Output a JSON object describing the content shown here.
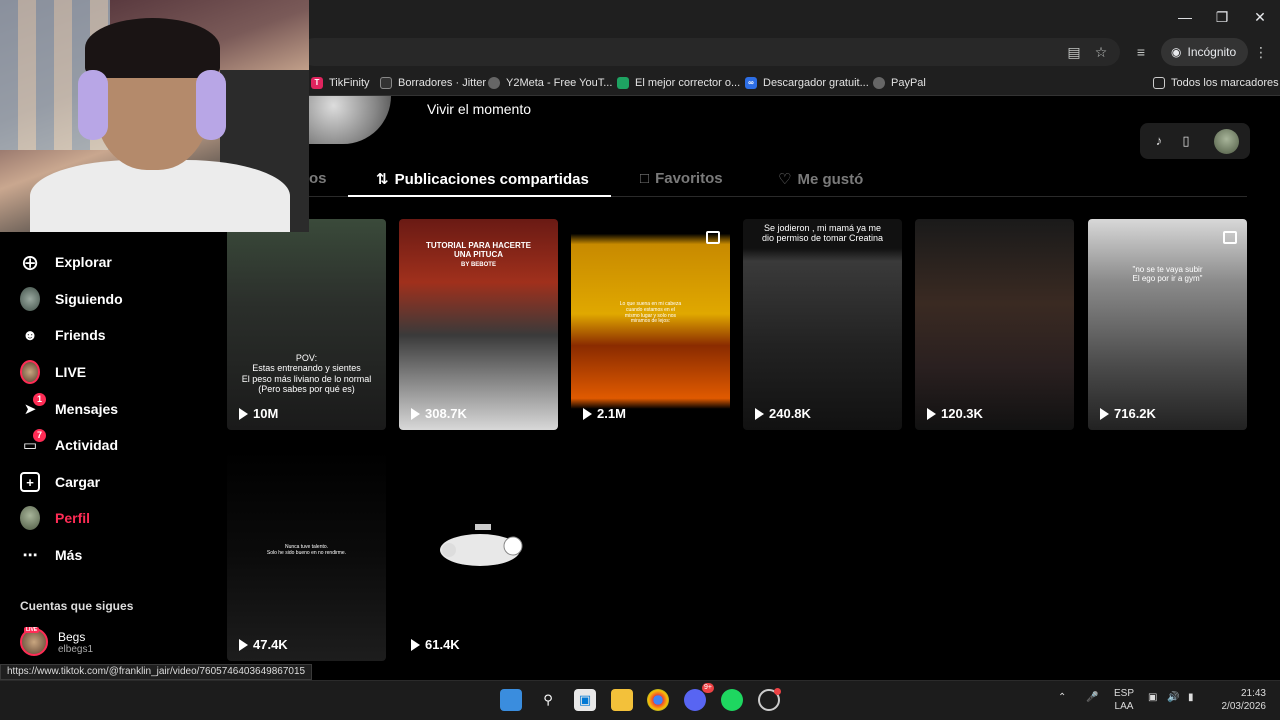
{
  "browser": {
    "incognito_label": "Incógnito",
    "bookmarks": [
      {
        "label": "TikFinity",
        "color": "#e0245e"
      },
      {
        "label": "Borradores · Jitter",
        "color": "#444444"
      },
      {
        "label": "Y2Meta - Free YouT...",
        "color": "#555555"
      },
      {
        "label": "El mejor corrector o...",
        "color": "#1ea362"
      },
      {
        "label": "Descargador gratuit...",
        "color": "#2d6ee5"
      },
      {
        "label": "PayPal",
        "color": "#555555"
      }
    ],
    "all_bookmarks_label": "Todos los marcadores"
  },
  "profile": {
    "bio": "Vivir el momento"
  },
  "tabs": {
    "partial": "os",
    "shared": "Publicaciones compartidas",
    "favorites": "Favoritos",
    "liked": "Me gustó"
  },
  "sidebar": {
    "items": [
      {
        "label": "Explorar",
        "icon": "compass-icon"
      },
      {
        "label": "Siguiendo",
        "icon": "following-avatar"
      },
      {
        "label": "Friends",
        "icon": "friends-icon"
      },
      {
        "label": "LIVE",
        "icon": "live-avatar"
      },
      {
        "label": "Mensajes",
        "icon": "messages-icon",
        "badge": "1"
      },
      {
        "label": "Actividad",
        "icon": "activity-icon",
        "badge": "7"
      },
      {
        "label": "Cargar",
        "icon": "upload-icon"
      },
      {
        "label": "Perfil",
        "icon": "profile-avatar"
      },
      {
        "label": "Más",
        "icon": "more-icon"
      }
    ],
    "following_title": "Cuentas que sigues",
    "following": [
      {
        "name": "Begs",
        "handle": "elbegs1",
        "live_tag": "LIVE"
      }
    ]
  },
  "videos": [
    {
      "views": "10M",
      "caption": "POV:\nEstas entrenando y sientes\nEl peso más liviano de lo normal\n(Pero sabes por qué es)"
    },
    {
      "views": "308.7K",
      "caption": "TUTORIAL PARA HACERTE\nUNA PITUCA",
      "sub": "BY BEBOTE"
    },
    {
      "views": "2.1M",
      "caption": "Lo que suena en mi cabeza\ncuando estamos en el\nmismo lugar y solo nos\nmiramos de lejos:"
    },
    {
      "views": "240.8K",
      "caption": "Se jodieron , mi mamá ya me\ndio permiso de tomar Creatina"
    },
    {
      "views": "120.3K",
      "caption": ""
    },
    {
      "views": "716.2K",
      "caption": "\"no se te vaya subir\nEl ego por ir a gym\""
    },
    {
      "views": "47.4K",
      "caption": "Nunca tuve talento.\nSolo he sido bueno en no rendirme."
    },
    {
      "views": "61.4K",
      "caption": ""
    }
  ],
  "status_url": "https://www.tiktok.com/@franklin_jair/video/7605746403649867015",
  "taskbar": {
    "discord_badge": "9+",
    "lang": "ESP",
    "layout": "LAA",
    "time": "21:43",
    "date": "2/03/2026"
  }
}
